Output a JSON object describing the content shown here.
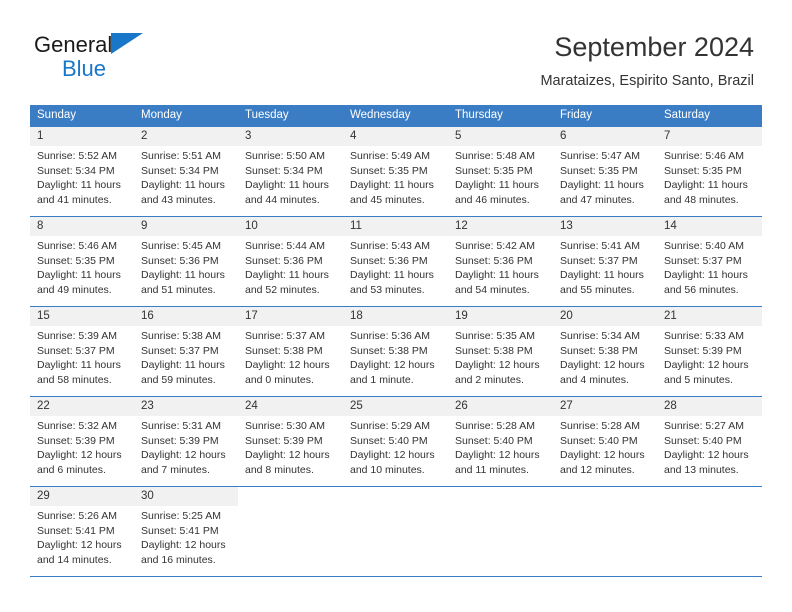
{
  "brand": {
    "name_top": "General",
    "name_bottom": "Blue",
    "flag_icon": "triangle-flag-icon",
    "accent_color": "#1877c9"
  },
  "header": {
    "title": "September 2024",
    "subtitle": "Marataizes, Espirito Santo, Brazil"
  },
  "calendar": {
    "header_bg_color": "#3b7dc4",
    "daynum_bg_color": "#f1f1f1",
    "weekday_headers": [
      "Sunday",
      "Monday",
      "Tuesday",
      "Wednesday",
      "Thursday",
      "Friday",
      "Saturday"
    ],
    "weeks": [
      [
        {
          "day": "1",
          "sunrise": "Sunrise: 5:52 AM",
          "sunset": "Sunset: 5:34 PM",
          "daylight_line1": "Daylight: 11 hours",
          "daylight_line2": "and 41 minutes."
        },
        {
          "day": "2",
          "sunrise": "Sunrise: 5:51 AM",
          "sunset": "Sunset: 5:34 PM",
          "daylight_line1": "Daylight: 11 hours",
          "daylight_line2": "and 43 minutes."
        },
        {
          "day": "3",
          "sunrise": "Sunrise: 5:50 AM",
          "sunset": "Sunset: 5:34 PM",
          "daylight_line1": "Daylight: 11 hours",
          "daylight_line2": "and 44 minutes."
        },
        {
          "day": "4",
          "sunrise": "Sunrise: 5:49 AM",
          "sunset": "Sunset: 5:35 PM",
          "daylight_line1": "Daylight: 11 hours",
          "daylight_line2": "and 45 minutes."
        },
        {
          "day": "5",
          "sunrise": "Sunrise: 5:48 AM",
          "sunset": "Sunset: 5:35 PM",
          "daylight_line1": "Daylight: 11 hours",
          "daylight_line2": "and 46 minutes."
        },
        {
          "day": "6",
          "sunrise": "Sunrise: 5:47 AM",
          "sunset": "Sunset: 5:35 PM",
          "daylight_line1": "Daylight: 11 hours",
          "daylight_line2": "and 47 minutes."
        },
        {
          "day": "7",
          "sunrise": "Sunrise: 5:46 AM",
          "sunset": "Sunset: 5:35 PM",
          "daylight_line1": "Daylight: 11 hours",
          "daylight_line2": "and 48 minutes."
        }
      ],
      [
        {
          "day": "8",
          "sunrise": "Sunrise: 5:46 AM",
          "sunset": "Sunset: 5:35 PM",
          "daylight_line1": "Daylight: 11 hours",
          "daylight_line2": "and 49 minutes."
        },
        {
          "day": "9",
          "sunrise": "Sunrise: 5:45 AM",
          "sunset": "Sunset: 5:36 PM",
          "daylight_line1": "Daylight: 11 hours",
          "daylight_line2": "and 51 minutes."
        },
        {
          "day": "10",
          "sunrise": "Sunrise: 5:44 AM",
          "sunset": "Sunset: 5:36 PM",
          "daylight_line1": "Daylight: 11 hours",
          "daylight_line2": "and 52 minutes."
        },
        {
          "day": "11",
          "sunrise": "Sunrise: 5:43 AM",
          "sunset": "Sunset: 5:36 PM",
          "daylight_line1": "Daylight: 11 hours",
          "daylight_line2": "and 53 minutes."
        },
        {
          "day": "12",
          "sunrise": "Sunrise: 5:42 AM",
          "sunset": "Sunset: 5:36 PM",
          "daylight_line1": "Daylight: 11 hours",
          "daylight_line2": "and 54 minutes."
        },
        {
          "day": "13",
          "sunrise": "Sunrise: 5:41 AM",
          "sunset": "Sunset: 5:37 PM",
          "daylight_line1": "Daylight: 11 hours",
          "daylight_line2": "and 55 minutes."
        },
        {
          "day": "14",
          "sunrise": "Sunrise: 5:40 AM",
          "sunset": "Sunset: 5:37 PM",
          "daylight_line1": "Daylight: 11 hours",
          "daylight_line2": "and 56 minutes."
        }
      ],
      [
        {
          "day": "15",
          "sunrise": "Sunrise: 5:39 AM",
          "sunset": "Sunset: 5:37 PM",
          "daylight_line1": "Daylight: 11 hours",
          "daylight_line2": "and 58 minutes."
        },
        {
          "day": "16",
          "sunrise": "Sunrise: 5:38 AM",
          "sunset": "Sunset: 5:37 PM",
          "daylight_line1": "Daylight: 11 hours",
          "daylight_line2": "and 59 minutes."
        },
        {
          "day": "17",
          "sunrise": "Sunrise: 5:37 AM",
          "sunset": "Sunset: 5:38 PM",
          "daylight_line1": "Daylight: 12 hours",
          "daylight_line2": "and 0 minutes."
        },
        {
          "day": "18",
          "sunrise": "Sunrise: 5:36 AM",
          "sunset": "Sunset: 5:38 PM",
          "daylight_line1": "Daylight: 12 hours",
          "daylight_line2": "and 1 minute."
        },
        {
          "day": "19",
          "sunrise": "Sunrise: 5:35 AM",
          "sunset": "Sunset: 5:38 PM",
          "daylight_line1": "Daylight: 12 hours",
          "daylight_line2": "and 2 minutes."
        },
        {
          "day": "20",
          "sunrise": "Sunrise: 5:34 AM",
          "sunset": "Sunset: 5:38 PM",
          "daylight_line1": "Daylight: 12 hours",
          "daylight_line2": "and 4 minutes."
        },
        {
          "day": "21",
          "sunrise": "Sunrise: 5:33 AM",
          "sunset": "Sunset: 5:39 PM",
          "daylight_line1": "Daylight: 12 hours",
          "daylight_line2": "and 5 minutes."
        }
      ],
      [
        {
          "day": "22",
          "sunrise": "Sunrise: 5:32 AM",
          "sunset": "Sunset: 5:39 PM",
          "daylight_line1": "Daylight: 12 hours",
          "daylight_line2": "and 6 minutes."
        },
        {
          "day": "23",
          "sunrise": "Sunrise: 5:31 AM",
          "sunset": "Sunset: 5:39 PM",
          "daylight_line1": "Daylight: 12 hours",
          "daylight_line2": "and 7 minutes."
        },
        {
          "day": "24",
          "sunrise": "Sunrise: 5:30 AM",
          "sunset": "Sunset: 5:39 PM",
          "daylight_line1": "Daylight: 12 hours",
          "daylight_line2": "and 8 minutes."
        },
        {
          "day": "25",
          "sunrise": "Sunrise: 5:29 AM",
          "sunset": "Sunset: 5:40 PM",
          "daylight_line1": "Daylight: 12 hours",
          "daylight_line2": "and 10 minutes."
        },
        {
          "day": "26",
          "sunrise": "Sunrise: 5:28 AM",
          "sunset": "Sunset: 5:40 PM",
          "daylight_line1": "Daylight: 12 hours",
          "daylight_line2": "and 11 minutes."
        },
        {
          "day": "27",
          "sunrise": "Sunrise: 5:28 AM",
          "sunset": "Sunset: 5:40 PM",
          "daylight_line1": "Daylight: 12 hours",
          "daylight_line2": "and 12 minutes."
        },
        {
          "day": "28",
          "sunrise": "Sunrise: 5:27 AM",
          "sunset": "Sunset: 5:40 PM",
          "daylight_line1": "Daylight: 12 hours",
          "daylight_line2": "and 13 minutes."
        }
      ],
      [
        {
          "day": "29",
          "sunrise": "Sunrise: 5:26 AM",
          "sunset": "Sunset: 5:41 PM",
          "daylight_line1": "Daylight: 12 hours",
          "daylight_line2": "and 14 minutes."
        },
        {
          "day": "30",
          "sunrise": "Sunrise: 5:25 AM",
          "sunset": "Sunset: 5:41 PM",
          "daylight_line1": "Daylight: 12 hours",
          "daylight_line2": "and 16 minutes."
        },
        {
          "day": "",
          "sunrise": "",
          "sunset": "",
          "daylight_line1": "",
          "daylight_line2": ""
        },
        {
          "day": "",
          "sunrise": "",
          "sunset": "",
          "daylight_line1": "",
          "daylight_line2": ""
        },
        {
          "day": "",
          "sunrise": "",
          "sunset": "",
          "daylight_line1": "",
          "daylight_line2": ""
        },
        {
          "day": "",
          "sunrise": "",
          "sunset": "",
          "daylight_line1": "",
          "daylight_line2": ""
        },
        {
          "day": "",
          "sunrise": "",
          "sunset": "",
          "daylight_line1": "",
          "daylight_line2": ""
        }
      ]
    ]
  }
}
